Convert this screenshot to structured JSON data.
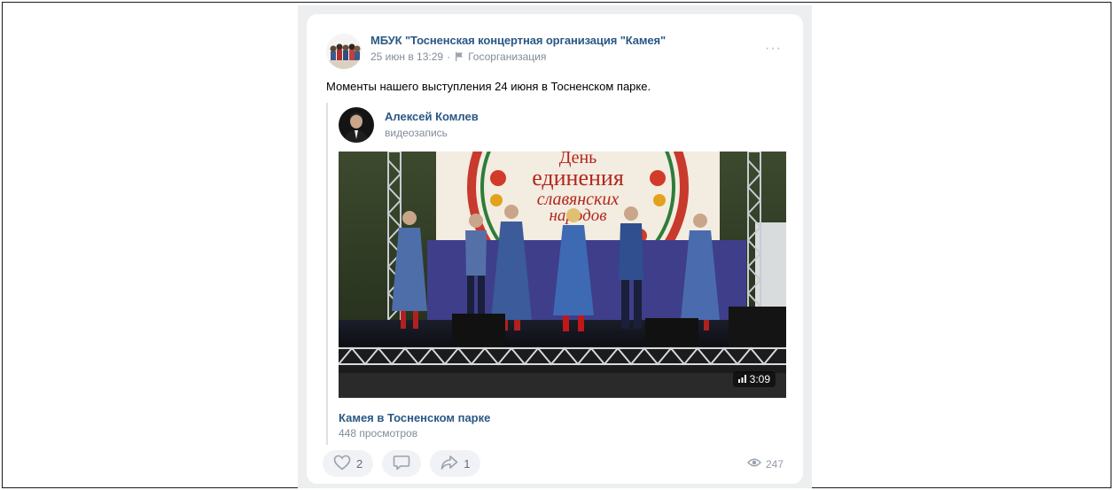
{
  "post": {
    "author_name": "МБУК \"Тосненская концертная организация \"Камея\"",
    "date": "25 июн в 13:29",
    "separator": "·",
    "org_type": "Госорганизация",
    "more_label": "···",
    "text": "Моменты нашего выступления 24 июня в Тосненском парке."
  },
  "repost": {
    "author_name": "Алексей Комлев",
    "subtitle": "видеозапись"
  },
  "video": {
    "banner_line1": "День",
    "banner_line2": "единения",
    "banner_line3": "славянских",
    "banner_line4": "народов",
    "duration": "3:09",
    "title": "Камея в Тосненском парке",
    "views": "448 просмотров"
  },
  "actions": {
    "likes": "2",
    "reposts": "1",
    "views": "247"
  },
  "colors": {
    "link": "#2a5885",
    "meta": "#818c99",
    "feed_bg": "#edeef0"
  }
}
